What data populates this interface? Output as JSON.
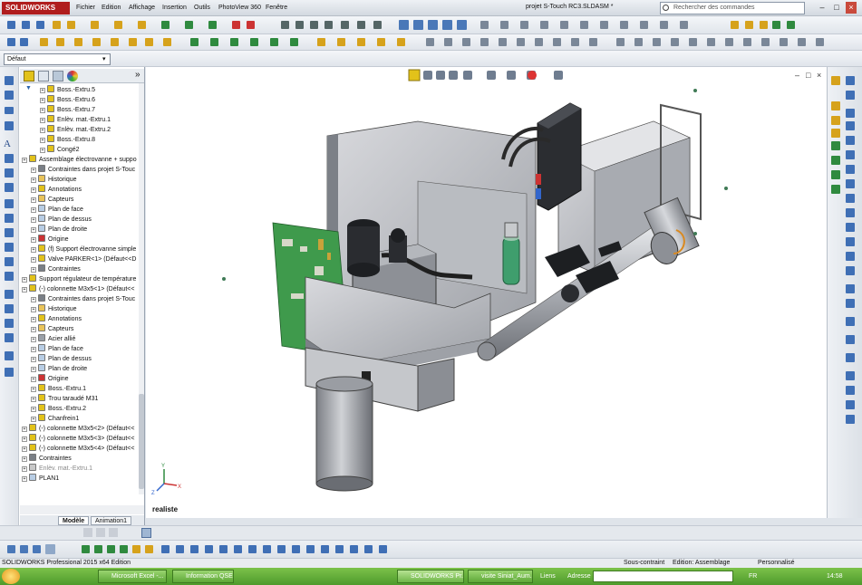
{
  "app": {
    "logo_text": "SOLIDWORKS",
    "document_title": "projet S-Touch RC3.SLDASM *",
    "menus": [
      "Fichier",
      "Edition",
      "Affichage",
      "Insertion",
      "Outils",
      "PhotoView 360",
      "Fenêtre"
    ],
    "search_placeholder": "Rechercher des commandes",
    "configuration": "Défaut"
  },
  "feature_tree": [
    {
      "label": "Boss.-Extru.5",
      "depth": 2,
      "icon": "feature"
    },
    {
      "label": "Boss.-Extru.6",
      "depth": 2,
      "icon": "feature"
    },
    {
      "label": "Boss.-Extru.7",
      "depth": 2,
      "icon": "feature"
    },
    {
      "label": "Enlèv. mat.-Extru.1",
      "depth": 2,
      "icon": "feature"
    },
    {
      "label": "Enlèv. mat.-Extru.2",
      "depth": 2,
      "icon": "feature"
    },
    {
      "label": "Boss.-Extru.8",
      "depth": 2,
      "icon": "feature"
    },
    {
      "label": "Congé2",
      "depth": 2,
      "icon": "feature"
    },
    {
      "label": "Assemblage électrovanne + suppo",
      "depth": 0,
      "icon": "assembly"
    },
    {
      "label": "Contraintes dans projet S-Touc",
      "depth": 1,
      "icon": "mates"
    },
    {
      "label": "Historique",
      "depth": 1,
      "icon": "folder"
    },
    {
      "label": "Annotations",
      "depth": 1,
      "icon": "annotation"
    },
    {
      "label": "Capteurs",
      "depth": 1,
      "icon": "folder"
    },
    {
      "label": "Plan de face",
      "depth": 1,
      "icon": "plane"
    },
    {
      "label": "Plan de dessus",
      "depth": 1,
      "icon": "plane"
    },
    {
      "label": "Plan de droite",
      "depth": 1,
      "icon": "plane"
    },
    {
      "label": "Origine",
      "depth": 1,
      "icon": "origin"
    },
    {
      "label": "(f) Support électrovanne simple",
      "depth": 1,
      "icon": "part"
    },
    {
      "label": "Valve PARKER<1> (Défaut<<D",
      "depth": 1,
      "icon": "part"
    },
    {
      "label": "Contraintes",
      "depth": 1,
      "icon": "mates"
    },
    {
      "label": "Support régulateur de température",
      "depth": 0,
      "icon": "assembly"
    },
    {
      "label": "(-) colonnette M3x5<1> (Défaut<<",
      "depth": 0,
      "icon": "part"
    },
    {
      "label": "Contraintes dans projet S-Touc",
      "depth": 1,
      "icon": "mates"
    },
    {
      "label": "Historique",
      "depth": 1,
      "icon": "folder"
    },
    {
      "label": "Annotations",
      "depth": 1,
      "icon": "annotation"
    },
    {
      "label": "Capteurs",
      "depth": 1,
      "icon": "folder"
    },
    {
      "label": "Acier allié",
      "depth": 1,
      "icon": "material"
    },
    {
      "label": "Plan de face",
      "depth": 1,
      "icon": "plane"
    },
    {
      "label": "Plan de dessus",
      "depth": 1,
      "icon": "plane"
    },
    {
      "label": "Plan de droite",
      "depth": 1,
      "icon": "plane"
    },
    {
      "label": "Origine",
      "depth": 1,
      "icon": "origin"
    },
    {
      "label": "Boss.-Extru.1",
      "depth": 1,
      "icon": "feature"
    },
    {
      "label": "Trou taraudé M31",
      "depth": 1,
      "icon": "feature"
    },
    {
      "label": "Boss.-Extru.2",
      "depth": 1,
      "icon": "feature"
    },
    {
      "label": "Chanfrein1",
      "depth": 1,
      "icon": "feature"
    },
    {
      "label": "(-) colonnette M3x5<2> (Défaut<<",
      "depth": 0,
      "icon": "part"
    },
    {
      "label": "(-) colonnette M3x5<3> (Défaut<<",
      "depth": 0,
      "icon": "part"
    },
    {
      "label": "(-) colonnette M3x5<4> (Défaut<<",
      "depth": 0,
      "icon": "part"
    },
    {
      "label": "Contraintes",
      "depth": 0,
      "icon": "mates"
    },
    {
      "label": "Enlèv. mat.-Extru.1",
      "depth": 0,
      "icon": "feature-gray"
    },
    {
      "label": "PLAN1",
      "depth": 0,
      "icon": "plane"
    }
  ],
  "bottom_tabs": [
    "Modèle",
    "Animation1"
  ],
  "viewport": {
    "display_state": "realiste"
  },
  "statusbar": {
    "edition": "SOLIDWORKS Professional 2015 x64 Edition",
    "state": "Sous-contraint",
    "mode": "Edition: Assemblage",
    "custom": "Personnalisé"
  },
  "taskbar": {
    "tasks": [
      "Microsoft Excel -...",
      "Information QSE...",
      "SOLIDWORKS Pr...",
      "visite Siniat_Aum..."
    ],
    "links_label": "Liens",
    "address_label": "Adresse",
    "lang": "FR",
    "time": "14:58"
  },
  "colors": {
    "accent_red": "#b01d1d",
    "taskbar_green": "#5ea838",
    "feature_yellow": "#e2c21a"
  }
}
